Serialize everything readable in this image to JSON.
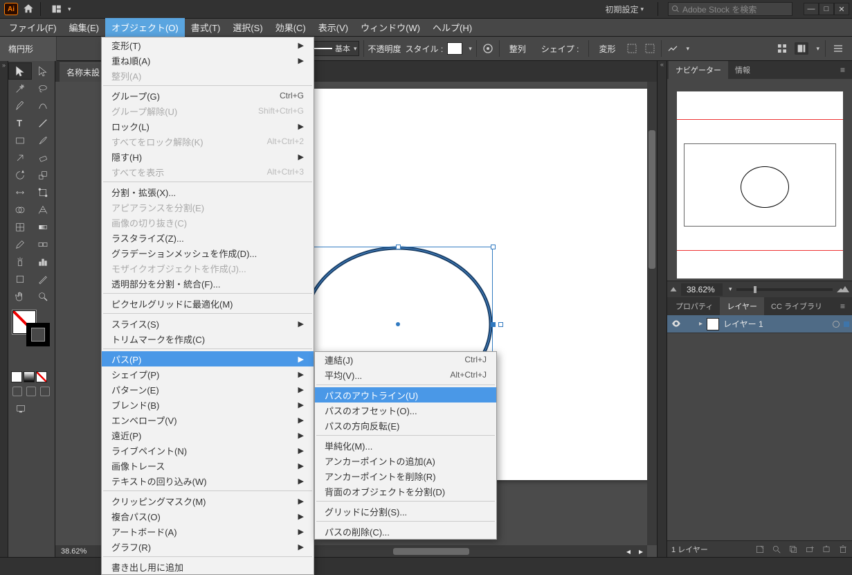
{
  "titlebar": {
    "workspace": "初期設定",
    "search_placeholder": "Adobe Stock を検索"
  },
  "menubar": {
    "file": "ファイル(F)",
    "edit": "編集(E)",
    "object": "オブジェクト(O)",
    "type": "書式(T)",
    "select": "選択(S)",
    "effect": "効果(C)",
    "view": "表示(V)",
    "window": "ウィンドウ(W)",
    "help": "ヘルプ(H)"
  },
  "options": {
    "shape_label": "楕円形",
    "stroke_style": "基本",
    "opacity_label": "不透明度",
    "style_label": "スタイル :",
    "align": "整列",
    "shape": "シェイプ :",
    "transform": "変形"
  },
  "doc": {
    "tab": "名称未設",
    "zoom": "38.62%"
  },
  "panels": {
    "navigator_tab": "ナビゲーター",
    "info_tab": "情報",
    "nav_zoom": "38.62%",
    "properties_tab": "プロパティ",
    "layers_tab": "レイヤー",
    "cc_tab": "CC ライブラリ",
    "layer1": "レイヤー 1",
    "layers_footer": "1 レイヤー"
  },
  "object_menu": [
    {
      "lbl": "変形(T)",
      "arr": true
    },
    {
      "lbl": "重ね順(A)",
      "arr": true
    },
    {
      "lbl": "整列(A)",
      "disabled": true
    },
    {
      "sep": true
    },
    {
      "lbl": "グループ(G)",
      "sc": "Ctrl+G"
    },
    {
      "lbl": "グループ解除(U)",
      "sc": "Shift+Ctrl+G",
      "disabled": true
    },
    {
      "lbl": "ロック(L)",
      "arr": true
    },
    {
      "lbl": "すべてをロック解除(K)",
      "sc": "Alt+Ctrl+2",
      "disabled": true
    },
    {
      "lbl": "隠す(H)",
      "arr": true
    },
    {
      "lbl": "すべてを表示",
      "sc": "Alt+Ctrl+3",
      "disabled": true
    },
    {
      "sep": true
    },
    {
      "lbl": "分割・拡張(X)..."
    },
    {
      "lbl": "アピアランスを分割(E)",
      "disabled": true
    },
    {
      "lbl": "画像の切り抜き(C)",
      "disabled": true
    },
    {
      "lbl": "ラスタライズ(Z)..."
    },
    {
      "lbl": "グラデーションメッシュを作成(D)..."
    },
    {
      "lbl": "モザイクオブジェクトを作成(J)...",
      "disabled": true
    },
    {
      "lbl": "透明部分を分割・統合(F)..."
    },
    {
      "sep": true
    },
    {
      "lbl": "ピクセルグリッドに最適化(M)"
    },
    {
      "sep": true
    },
    {
      "lbl": "スライス(S)",
      "arr": true
    },
    {
      "lbl": "トリムマークを作成(C)"
    },
    {
      "sep": true
    },
    {
      "lbl": "パス(P)",
      "arr": true,
      "hl": true
    },
    {
      "lbl": "シェイプ(P)",
      "arr": true
    },
    {
      "lbl": "パターン(E)",
      "arr": true
    },
    {
      "lbl": "ブレンド(B)",
      "arr": true
    },
    {
      "lbl": "エンベロープ(V)",
      "arr": true
    },
    {
      "lbl": "遠近(P)",
      "arr": true
    },
    {
      "lbl": "ライブペイント(N)",
      "arr": true
    },
    {
      "lbl": "画像トレース",
      "arr": true
    },
    {
      "lbl": "テキストの回り込み(W)",
      "arr": true
    },
    {
      "sep": true
    },
    {
      "lbl": "クリッピングマスク(M)",
      "arr": true
    },
    {
      "lbl": "複合パス(O)",
      "arr": true
    },
    {
      "lbl": "アートボード(A)",
      "arr": true
    },
    {
      "lbl": "グラフ(R)",
      "arr": true
    },
    {
      "sep": true
    },
    {
      "lbl": "書き出し用に追加"
    }
  ],
  "path_submenu": [
    {
      "lbl": "連結(J)",
      "sc": "Ctrl+J"
    },
    {
      "lbl": "平均(V)...",
      "sc": "Alt+Ctrl+J"
    },
    {
      "sep": true
    },
    {
      "lbl": "パスのアウトライン(U)",
      "hl": true
    },
    {
      "lbl": "パスのオフセット(O)..."
    },
    {
      "lbl": "パスの方向反転(E)"
    },
    {
      "sep": true
    },
    {
      "lbl": "単純化(M)..."
    },
    {
      "lbl": "アンカーポイントの追加(A)"
    },
    {
      "lbl": "アンカーポイントを削除(R)"
    },
    {
      "lbl": "背面のオブジェクトを分割(D)"
    },
    {
      "sep": true
    },
    {
      "lbl": "グリッドに分割(S)..."
    },
    {
      "sep": true
    },
    {
      "lbl": "パスの削除(C)..."
    }
  ]
}
